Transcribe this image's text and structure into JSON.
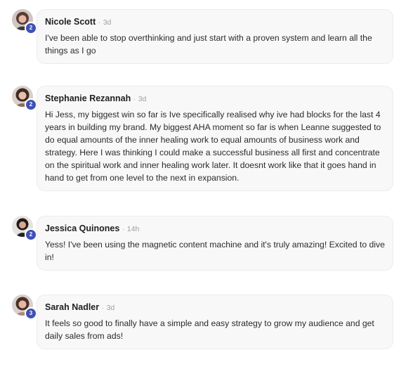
{
  "comments": [
    {
      "author": "Nicole Scott",
      "time": "3d",
      "level": "2",
      "text": "I've been able to stop overthinking and just start with a proven system and learn all the things as I go"
    },
    {
      "author": "Stephanie Rezannah",
      "time": "3d",
      "level": "2",
      "text": "Hi Jess, my biggest win so far is Ive specifically realised why ive had blocks for the last 4 years in building my brand. My biggest AHA moment so far is when Leanne suggested to do equal amounts of the inner healing work to equal amounts of business work and strategy. Here I was thinking I could make a successful business all first and concentrate on the spiritual work and inner healing work later. It doesnt work like that it goes hand in hand to get from one level to the next in expansion."
    },
    {
      "author": "Jessica Quinones",
      "time": "14h",
      "level": "2",
      "text": "Yess! I've been using the magnetic content machine and it's truly amazing! Excited to dive in!"
    },
    {
      "author": "Sarah Nadler",
      "time": "3d",
      "level": "3",
      "text": "It feels so good to finally have a simple and easy strategy to grow my audience and get daily sales from ads!"
    }
  ],
  "separator": "·",
  "colors": {
    "badge": "#3f51b5",
    "bubble": "#f8f8f8"
  }
}
